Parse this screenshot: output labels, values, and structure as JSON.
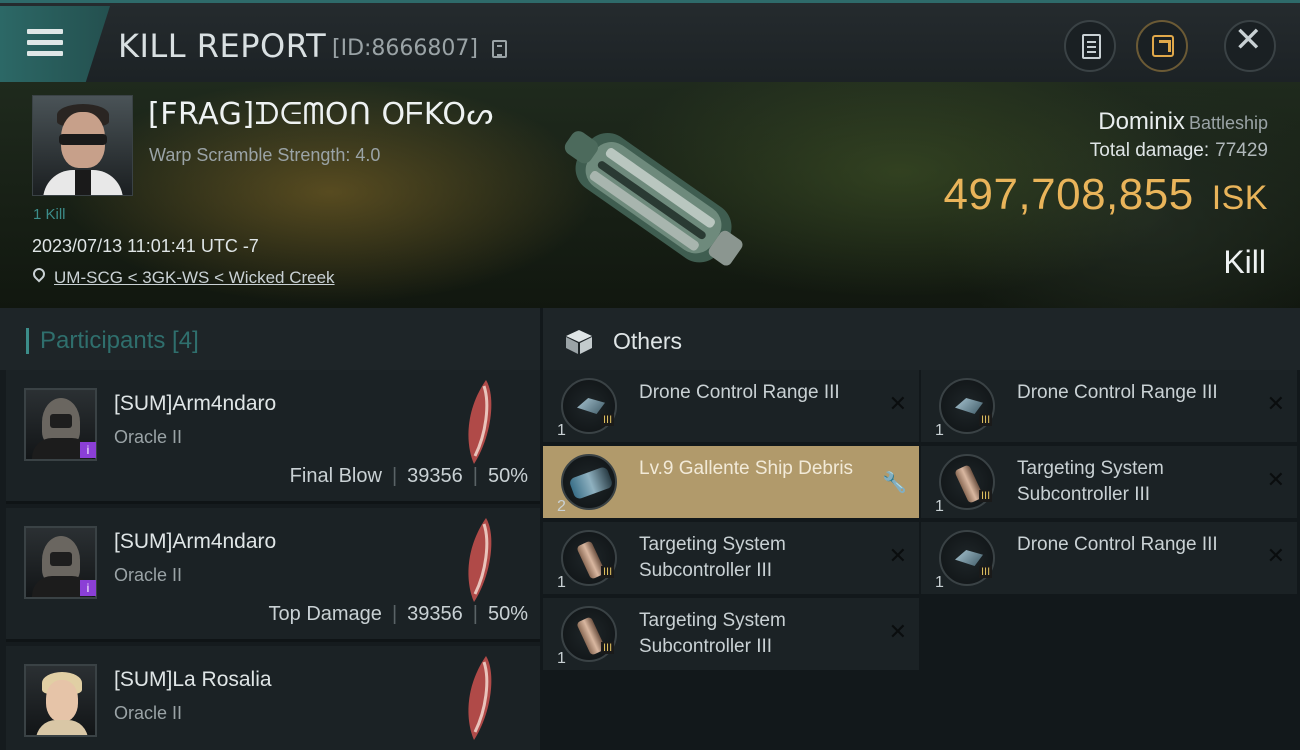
{
  "header": {
    "title": "KILL REPORT",
    "report_id": "[ID:8666807]"
  },
  "victim": {
    "name": "[FRAG]ᗪᕮᗰOᑎ OᖴKOᔕ",
    "scramble": "Warp Scramble Strength: 4.0",
    "kill_tag": "1 Kill",
    "timestamp": "2023/07/13 11:01:41 UTC -7",
    "location": "UM-SCG < 3GK-WS < Wicked Creek",
    "ship_name": "Dominix",
    "ship_class": "Battleship",
    "total_damage_label": "Total damage:",
    "total_damage": "77429",
    "isk_value": "497,708,855",
    "isk_unit": "ISK",
    "result": "Kill"
  },
  "participants": {
    "title": "Participants [4]",
    "items": [
      {
        "name": "[SUM]Arm4ndaro",
        "ship": "Oracle II",
        "role": "Final Blow",
        "damage": "39356",
        "percent": "50%",
        "badge": "i"
      },
      {
        "name": "[SUM]Arm4ndaro",
        "ship": "Oracle II",
        "role": "Top Damage",
        "damage": "39356",
        "percent": "50%",
        "badge": "i"
      },
      {
        "name": "[SUM]La Rosalia",
        "ship": "Oracle II"
      }
    ]
  },
  "others": {
    "title": "Others",
    "items": [
      {
        "name": "Drone Control Range III",
        "qty": "1",
        "tier": "III",
        "icon": "drone-icon"
      },
      {
        "name": "Drone Control Range III",
        "qty": "1",
        "tier": "III",
        "icon": "drone-icon"
      },
      {
        "name": "Lv.9 Gallente Ship Debris",
        "qty": "2",
        "icon": "debris-icon",
        "highlight": true
      },
      {
        "name": "Targeting System Subcontroller III",
        "qty": "1",
        "tier": "III",
        "icon": "targeting-icon"
      },
      {
        "name": "Targeting System Subcontroller III",
        "qty": "1",
        "tier": "III",
        "icon": "targeting-icon"
      },
      {
        "name": "Drone Control Range III",
        "qty": "1",
        "tier": "III",
        "icon": "drone-icon"
      },
      {
        "name": "Targeting System Subcontroller III",
        "qty": "1",
        "tier": "III",
        "icon": "targeting-icon"
      }
    ]
  },
  "colors": {
    "accent": "#3c8d8a",
    "isk": "#e9b45a",
    "highlight": "#b19a6b"
  }
}
